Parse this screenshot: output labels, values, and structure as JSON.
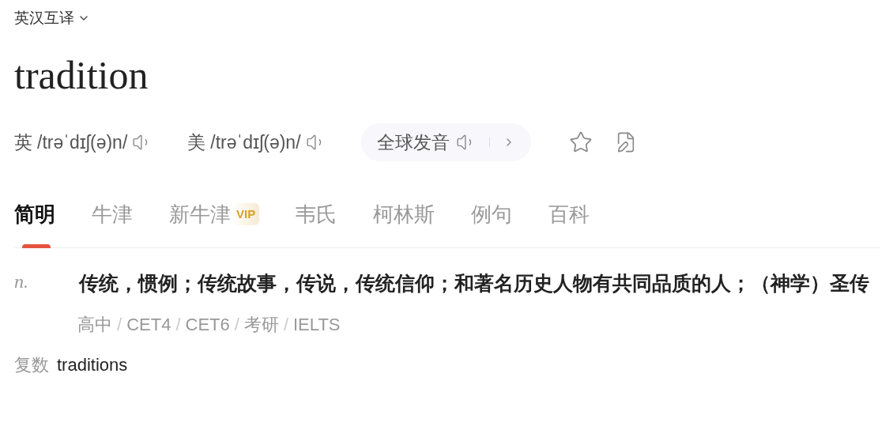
{
  "mode_selector": {
    "label": "英汉互译"
  },
  "word": "tradition",
  "pronunciations": [
    {
      "region": "英",
      "phonetic": "/trəˈdɪʃ(ə)n/"
    },
    {
      "region": "美",
      "phonetic": "/trəˈdɪʃ(ə)n/"
    }
  ],
  "global_pronunciation": {
    "label": "全球发音"
  },
  "tabs": [
    {
      "label": "简明",
      "selected": true
    },
    {
      "label": "牛津",
      "selected": false
    },
    {
      "label": "新牛津",
      "selected": false,
      "badge": "VIP"
    },
    {
      "label": "韦氏",
      "selected": false
    },
    {
      "label": "柯林斯",
      "selected": false
    },
    {
      "label": "例句",
      "selected": false
    },
    {
      "label": "百科",
      "selected": false
    }
  ],
  "definitions": [
    {
      "pos": "n.",
      "meaning": "传统，惯例；传统故事，传说，传统信仰；和著名历史人物有共同品质的人；（神学）圣传"
    }
  ],
  "tags": [
    "高中",
    "CET4",
    "CET6",
    "考研",
    "IELTS"
  ],
  "tag_separator": "/",
  "forms": [
    {
      "label": "复数",
      "value": "traditions"
    }
  ]
}
